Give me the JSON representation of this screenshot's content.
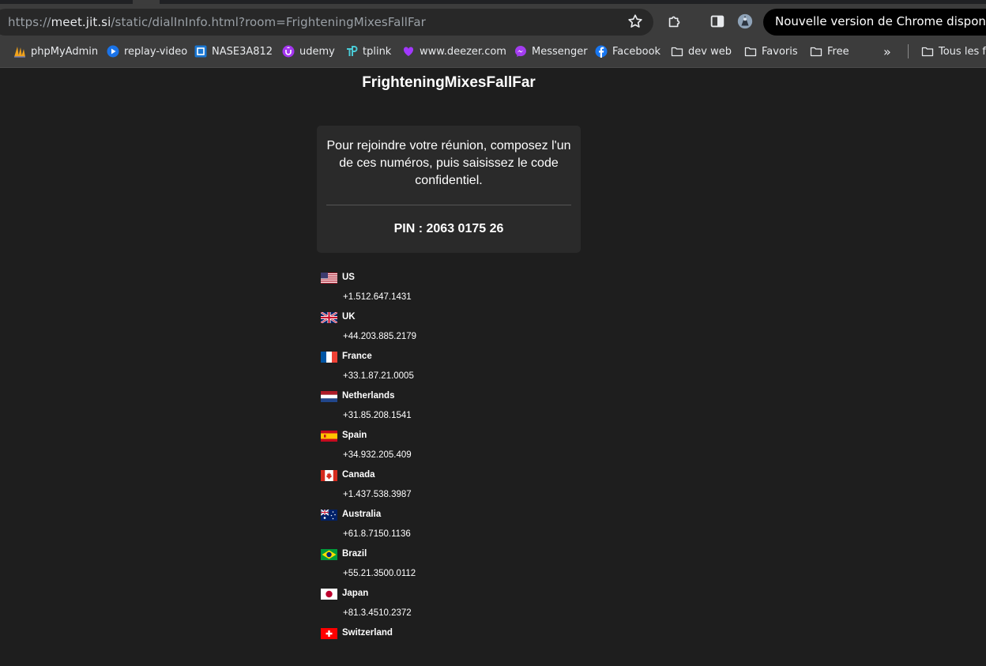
{
  "browser": {
    "url_prefix": "https://",
    "url_host": "meet.jit.si",
    "url_path": "/static/dialInInfo.html?room=FrighteningMixesFallFar",
    "update_notice": "Nouvelle version de Chrome disponible",
    "bookmarks": [
      {
        "label": "phpMyAdmin",
        "icon": "phpmyadmin-icon"
      },
      {
        "label": "replay-video",
        "icon": "play-icon"
      },
      {
        "label": "NASE3A812",
        "icon": "nas-icon"
      },
      {
        "label": "udemy",
        "icon": "udemy-icon"
      },
      {
        "label": "tplink",
        "icon": "tplink-icon"
      },
      {
        "label": "www.deezer.com",
        "icon": "heart-icon"
      },
      {
        "label": "Messenger",
        "icon": "messenger-icon"
      },
      {
        "label": "Facebook",
        "icon": "facebook-icon"
      },
      {
        "label": "dev web",
        "icon": "folder-icon"
      },
      {
        "label": "Favoris",
        "icon": "folder-icon"
      },
      {
        "label": "Free",
        "icon": "folder-icon"
      }
    ],
    "overflow_label": "»",
    "all_bookmarks_label": "Tous les favoris"
  },
  "page": {
    "room_name": "FrighteningMixesFallFar",
    "instructions": "Pour rejoindre votre réunion, composez l'un de ces numéros, puis saisissez le code confidentiel.",
    "pin_label": "PIN : 2063 0175 26",
    "countries": [
      {
        "name": "US",
        "number": "+1.512.647.1431",
        "flag": "us"
      },
      {
        "name": "UK",
        "number": "+44.203.885.2179",
        "flag": "uk"
      },
      {
        "name": "France",
        "number": "+33.1.87.21.0005",
        "flag": "fr"
      },
      {
        "name": "Netherlands",
        "number": "+31.85.208.1541",
        "flag": "nl"
      },
      {
        "name": "Spain",
        "number": "+34.932.205.409",
        "flag": "es"
      },
      {
        "name": "Canada",
        "number": "+1.437.538.3987",
        "flag": "ca"
      },
      {
        "name": "Australia",
        "number": "+61.8.7150.1136",
        "flag": "au"
      },
      {
        "name": "Brazil",
        "number": "+55.21.3500.0112",
        "flag": "br"
      },
      {
        "name": "Japan",
        "number": "+81.3.4510.2372",
        "flag": "jp"
      },
      {
        "name": "Switzerland",
        "number": "",
        "flag": "ch"
      }
    ]
  }
}
